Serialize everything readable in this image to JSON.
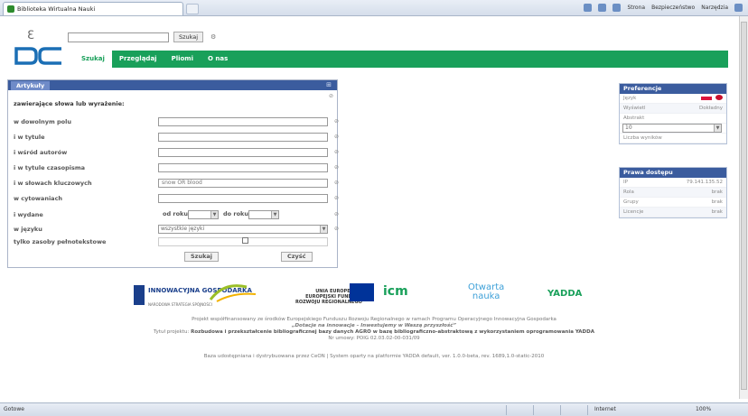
{
  "browser": {
    "tab_title": "Biblioteka Wirtualna Nauki",
    "commands": [
      "Strona",
      "Bezpieczeństwo",
      "Narzędzia"
    ],
    "status_left": "Gotowe",
    "status_zone": "Internet",
    "status_zoom": "100%"
  },
  "header": {
    "search_button": "Szukaj",
    "nav": [
      "Szukaj",
      "Przeglądaj",
      "Pliomi",
      "O nas"
    ]
  },
  "search_panel": {
    "tab_label": "Artykuły",
    "form_title": "zawierające słowa lub wyrażenie:",
    "fields": [
      {
        "label": "w dowolnym polu",
        "value": ""
      },
      {
        "label": "i w tytule",
        "value": ""
      },
      {
        "label": "i wśród autorów",
        "value": ""
      },
      {
        "label": "i w tytule czasopisma",
        "value": ""
      },
      {
        "label": "i w słowach kluczowych",
        "value": "snow OR blood"
      },
      {
        "label": "w cytowaniach",
        "value": ""
      }
    ],
    "year_label": "i wydane",
    "year_from_label": "od roku",
    "year_to_label": "do roku",
    "language_label": "w języku",
    "language_value": "wszystkie języki",
    "fulltext_label": "tylko zasoby pełnotekstowe",
    "submit_label": "Szukaj",
    "clear_label": "Czyść"
  },
  "preferences": {
    "title": "Preferencje",
    "rows": [
      {
        "label": "Język",
        "value": ""
      },
      {
        "label": "Wyświetl",
        "value": "Dokładny"
      },
      {
        "label": "Abstrakt",
        "value": ""
      },
      {
        "label": "10",
        "value": ""
      },
      {
        "label": "Liczba wyników",
        "value": ""
      }
    ]
  },
  "access": {
    "title": "Prawa dostępu",
    "rows": [
      {
        "label": "IP",
        "value": "79.141.135.52"
      },
      {
        "label": "Rola",
        "value": "brak"
      },
      {
        "label": "Grupy",
        "value": "brak"
      },
      {
        "label": "Licencje",
        "value": "brak"
      }
    ]
  },
  "footer": {
    "logos": {
      "innowacyjna": "INNOWACYJNA GOSPODARKA",
      "innowacyjna_sub": "NARODOWA STRATEGIA SPÓJNOŚCI",
      "ue": "UNIA EUROPEJSKA\nEUROPEJSKI FUNDUSZ\nROZWOJU REGIONALNEGO",
      "icm": "icm",
      "otwarta": "Otwarta\nnauka",
      "yadda": "YADDA"
    },
    "line1": "Projekt współfinansowany ze środków Europejskiego Funduszu Rozwoju Regionalnego w ramach Programu Operacyjnego Innowacyjna Gospodarka",
    "line2": "„Dotacje na innowacje – Inwestujemy w Waszą przyszłość”",
    "line3_prefix": "Tytuł projektu:",
    "line3": "Rozbudowa i przekształcenie bibliograficznej bazy danych AGRO w bazę bibliograficzno-abstraktową z wykorzystaniem oprogramowania YADDA",
    "line4": "Nr umowy: POIG 02.03.02-00-031/09",
    "line5": "Baza udostępniana i dystrybuowana przez CeON | System oparty na platformie YADDA default, ver. 1.0.0-beta, rev. 1689,1.0-static-2010"
  }
}
